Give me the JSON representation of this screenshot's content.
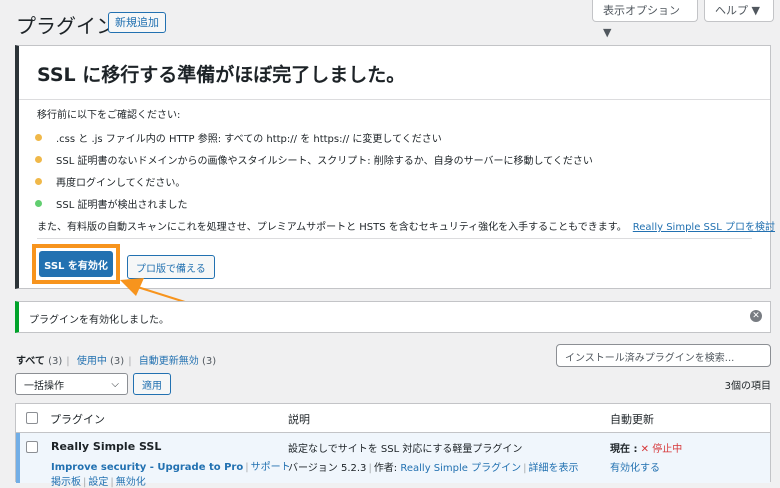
{
  "header": {
    "title": "プラグイン",
    "add_new": "新規追加",
    "screen_options": "表示オプション ▼",
    "help": "ヘルプ ▼"
  },
  "ssl_card": {
    "heading": "SSL に移行する準備がほぼ完了しました。",
    "intro": "移行前に以下をご確認ください:",
    "items": [
      {
        "text": ".css と .js ファイル内の HTTP 参照: すべての http:// を https:// に変更してください",
        "status_color": "#f0b849"
      },
      {
        "text": "SSL 証明書のないドメインからの画像やスタイルシート、スクリプト: 削除するか、自身のサーバーに移動してください",
        "status_color": "#f0b849"
      },
      {
        "text": "再度ログインしてください。",
        "status_color": "#f0b849"
      },
      {
        "text": "SSL 証明書が検出されました",
        "status_color": "#61ce70"
      }
    ],
    "more_text": "また、有料版の自動スキャンにこれを処理させ、プレミアムサポートと HSTS を含むセキュリティ強化を入手することもできます。",
    "more_link": "Really Simple SSL プロを検討",
    "activate_button": "SSL を有効化",
    "pro_button": "プロ版で備える"
  },
  "notice": {
    "message": "プラグインを有効化しました。"
  },
  "filters": {
    "all_label": "すべて",
    "all_count": "(3)",
    "active_label": "使用中",
    "active_count": "(3)",
    "auto_label": "自動更新無効",
    "auto_count": "(3)"
  },
  "search": {
    "placeholder": "インストール済みプラグインを検索..."
  },
  "bulk": {
    "selected": "一括操作",
    "apply": "適用",
    "items_count": "3個の項目"
  },
  "table": {
    "columns": [
      "プラグイン",
      "説明",
      "自動更新"
    ],
    "rows": [
      {
        "name": "Really Simple SSL",
        "action_improve": "Improve security - Upgrade to Pro",
        "action_support": "サポート",
        "action_forum": "掲示板",
        "action_settings": "設定",
        "action_deactivate": "無効化",
        "description": "設定なしでサイトを SSL 対応にする軽量プラグイン",
        "version_label": "バージョン 5.2.3",
        "author_label": "作者:",
        "author": "Really Simple プラグイン",
        "details": "詳細を表示",
        "auto_status_label": "現在 :",
        "auto_status": "✕ 停止中",
        "auto_enable": "有効化する"
      }
    ]
  },
  "colors": {
    "accent": "#2271b1",
    "highlight": "#f7941d",
    "success": "#00a32a",
    "danger": "#d63638"
  }
}
